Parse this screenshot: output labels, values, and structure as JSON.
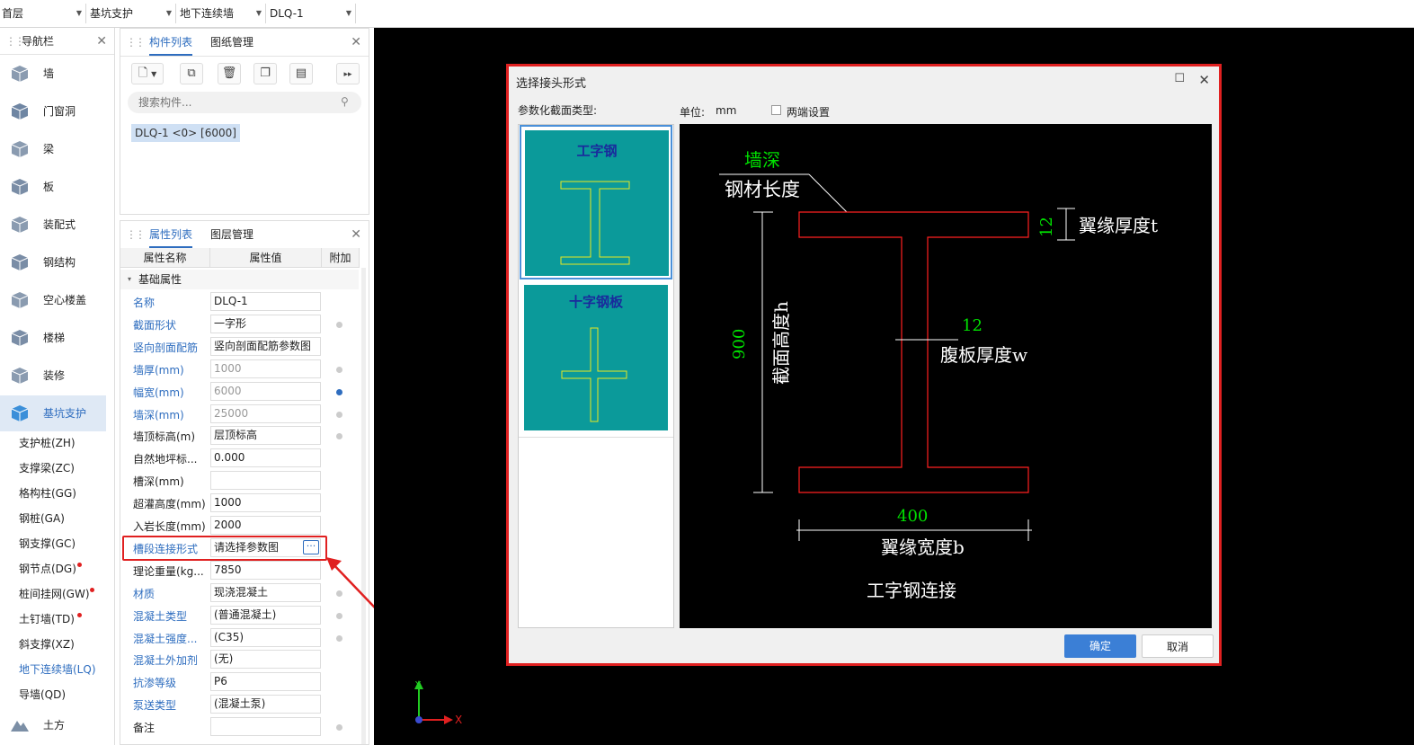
{
  "topbar": {
    "floor": "首层",
    "category": "基坑支护",
    "type": "地下连续墙",
    "component": "DLQ-1"
  },
  "nav": {
    "title": "导航栏",
    "items": [
      {
        "label": "墙",
        "icon": "wall-icon"
      },
      {
        "label": "门窗洞",
        "icon": "door-window-icon"
      },
      {
        "label": "梁",
        "icon": "beam-icon"
      },
      {
        "label": "板",
        "icon": "slab-icon"
      },
      {
        "label": "装配式",
        "icon": "prefab-icon"
      },
      {
        "label": "钢结构",
        "icon": "steel-structure-icon"
      },
      {
        "label": "空心楼盖",
        "icon": "hollow-floor-icon"
      },
      {
        "label": "楼梯",
        "icon": "stairs-icon"
      },
      {
        "label": "装修",
        "icon": "decoration-icon"
      },
      {
        "label": "基坑支护",
        "icon": "foundation-pit-icon"
      }
    ],
    "subitems": [
      "支护桩(ZH)",
      "支撑梁(ZC)",
      "格构柱(GG)",
      "钢桩(GA)",
      "钢支撑(GC)",
      "钢节点(DG)",
      "桩间挂网(GW)",
      "土钉墙(TD)",
      "斜支撑(XZ)",
      "地下连续墙(LQ)",
      "导墙(QD)"
    ],
    "last_item": "土方"
  },
  "components": {
    "tab1": "构件列表",
    "tab2": "图纸管理",
    "search_placeholder": "搜索构件...",
    "item": "DLQ-1 <0> [6000]"
  },
  "properties": {
    "tab1": "属性列表",
    "tab2": "图层管理",
    "col_name": "属性名称",
    "col_value": "属性值",
    "col_extra": "附加",
    "group": "基础属性",
    "rows": [
      {
        "name": "名称",
        "value": "DLQ-1"
      },
      {
        "name": "截面形状",
        "value": "一字形"
      },
      {
        "name": "竖向剖面配筋",
        "value": "竖向剖面配筋参数图"
      },
      {
        "name": "墙厚(mm)",
        "value": "1000"
      },
      {
        "name": "幅宽(mm)",
        "value": "6000"
      },
      {
        "name": "墙深(mm)",
        "value": "25000"
      },
      {
        "name": "墙顶标高(m)",
        "value": "层顶标高"
      },
      {
        "name": "自然地坪标...",
        "value": "0.000"
      },
      {
        "name": "槽深(mm)",
        "value": ""
      },
      {
        "name": "超灌高度(mm)",
        "value": "1000"
      },
      {
        "name": "入岩长度(mm)",
        "value": "2000"
      },
      {
        "name": "槽段连接形式",
        "value": "请选择参数图"
      },
      {
        "name": "理论重量(kg...",
        "value": "7850"
      },
      {
        "name": "材质",
        "value": "现浇混凝土"
      },
      {
        "name": "混凝土类型",
        "value": "(普通混凝土)"
      },
      {
        "name": "混凝土强度...",
        "value": "(C35)"
      },
      {
        "name": "混凝土外加剂",
        "value": "(无)"
      },
      {
        "name": "抗渗等级",
        "value": "P6"
      },
      {
        "name": "泵送类型",
        "value": "(混凝土泵)"
      },
      {
        "name": "备注",
        "value": ""
      }
    ]
  },
  "dialog": {
    "title": "选择接头形式",
    "type_label": "参数化截面类型:",
    "unit_label": "单位:",
    "unit_value": "mm",
    "checkbox_label": "两端设置",
    "options": [
      "工字钢",
      "十字钢板"
    ],
    "ok": "确定",
    "cancel": "取消",
    "drawing": {
      "wall_depth": "墙深",
      "steel_length": "钢材长度",
      "flange_t_value": "12",
      "flange_t_label": "翼缘厚度t",
      "height_value": "900",
      "height_label": "截面高度h",
      "web_value": "12",
      "web_label": "腹板厚度w",
      "width_value": "400",
      "width_label": "翼缘宽度b",
      "caption": "工字钢连接"
    }
  },
  "colors": {
    "accent": "#2e6dbf",
    "highlight": "#e02020",
    "tile": "#0b9a9a",
    "dim_green": "#00e000",
    "shape_red": "#ff2020",
    "shape_yellow": "#e8e820"
  }
}
